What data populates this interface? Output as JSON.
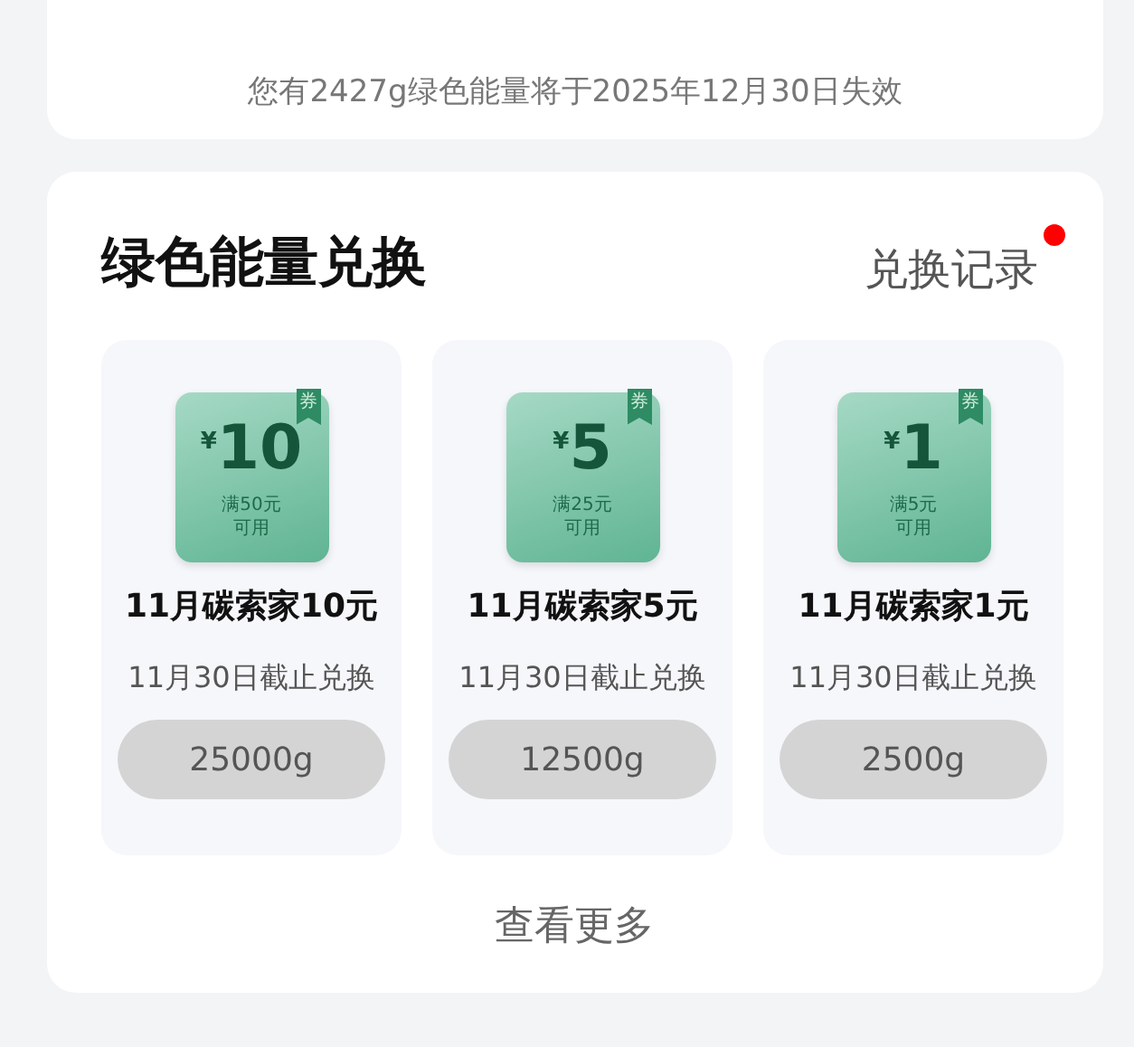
{
  "notice": "您有2427g绿色能量将于2025年12月30日失效",
  "exchange": {
    "title": "绿色能量兑换",
    "record_link": "兑换记录",
    "record_unread": true,
    "items": [
      {
        "tag": "券",
        "currency": "¥",
        "amount": "10",
        "condition": "满50元",
        "usable": "可用",
        "name": "11月碳索家10元",
        "deadline": "11月30日截止兑换",
        "cost": "25000g",
        "disabled": true
      },
      {
        "tag": "券",
        "currency": "¥",
        "amount": "5",
        "condition": "满25元",
        "usable": "可用",
        "name": "11月碳索家5元",
        "deadline": "11月30日截止兑换",
        "cost": "12500g",
        "disabled": true
      },
      {
        "tag": "券",
        "currency": "¥",
        "amount": "1",
        "condition": "满5元",
        "usable": "可用",
        "name": "11月碳索家1元",
        "deadline": "11月30日截止兑换",
        "cost": "2500g",
        "disabled": true
      }
    ],
    "more": "查看更多"
  }
}
